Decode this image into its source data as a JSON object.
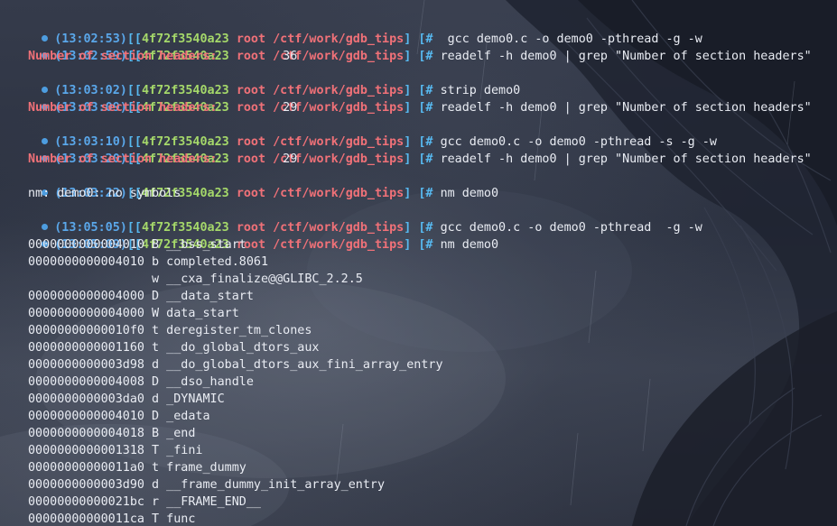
{
  "prompt_parts": {
    "host": "4f72f3540a23",
    "user": "root",
    "path": "/ctf/work/gdb_tips"
  },
  "colors": {
    "timestamp": "#5aa7ea",
    "host": "#a5d86a",
    "user_path": "#f07178",
    "dot": "#4d9de0",
    "text": "#e9ecf3"
  },
  "commands": [
    {
      "time": "(13:02:53)",
      "cmd": " gcc demo0.c -o demo0 -pthread -g -w"
    },
    {
      "time": "(13:02:59)",
      "cmd": "readelf -h demo0 | grep \"Number of section headers\""
    },
    {
      "time": "(13:03:02)",
      "cmd": "strip demo0"
    },
    {
      "time": "(13:03:09)",
      "cmd": "readelf -h demo0 | grep \"Number of section headers\""
    },
    {
      "time": "(13:03:10)",
      "cmd": "gcc demo0.c -o demo0 -pthread -s -g -w"
    },
    {
      "time": "(13:03:20)",
      "cmd": "readelf -h demo0 | grep \"Number of section headers\""
    },
    {
      "time": "(13:03:22)",
      "cmd": "nm demo0"
    },
    {
      "time": "(13:05:05)",
      "cmd": "gcc demo0.c -o demo0 -pthread  -g -w"
    },
    {
      "time": "(13:05:09)",
      "cmd": "nm demo0"
    }
  ],
  "outputs": {
    "section_headers_1": {
      "key": "Number of section headers:",
      "value": "36"
    },
    "section_headers_2": {
      "key": "Number of section headers:",
      "value": "29"
    },
    "section_headers_3": {
      "key": "Number of section headers:",
      "value": "29"
    },
    "nm_error": "nm: demo0: no symbols"
  },
  "nm_symbols": [
    "0000000000004010 B __bss_start",
    "0000000000004010 b completed.8061",
    "                 w __cxa_finalize@@GLIBC_2.2.5",
    "0000000000004000 D __data_start",
    "0000000000004000 W data_start",
    "00000000000010f0 t deregister_tm_clones",
    "0000000000001160 t __do_global_dtors_aux",
    "0000000000003d98 d __do_global_dtors_aux_fini_array_entry",
    "0000000000004008 D __dso_handle",
    "0000000000003da0 d _DYNAMIC",
    "0000000000004010 D _edata",
    "0000000000004018 B _end",
    "0000000000001318 T _fini",
    "00000000000011a0 t frame_dummy",
    "0000000000003d90 d __frame_dummy_init_array_entry",
    "00000000000021bc r __FRAME_END__",
    "00000000000011ca T func"
  ]
}
